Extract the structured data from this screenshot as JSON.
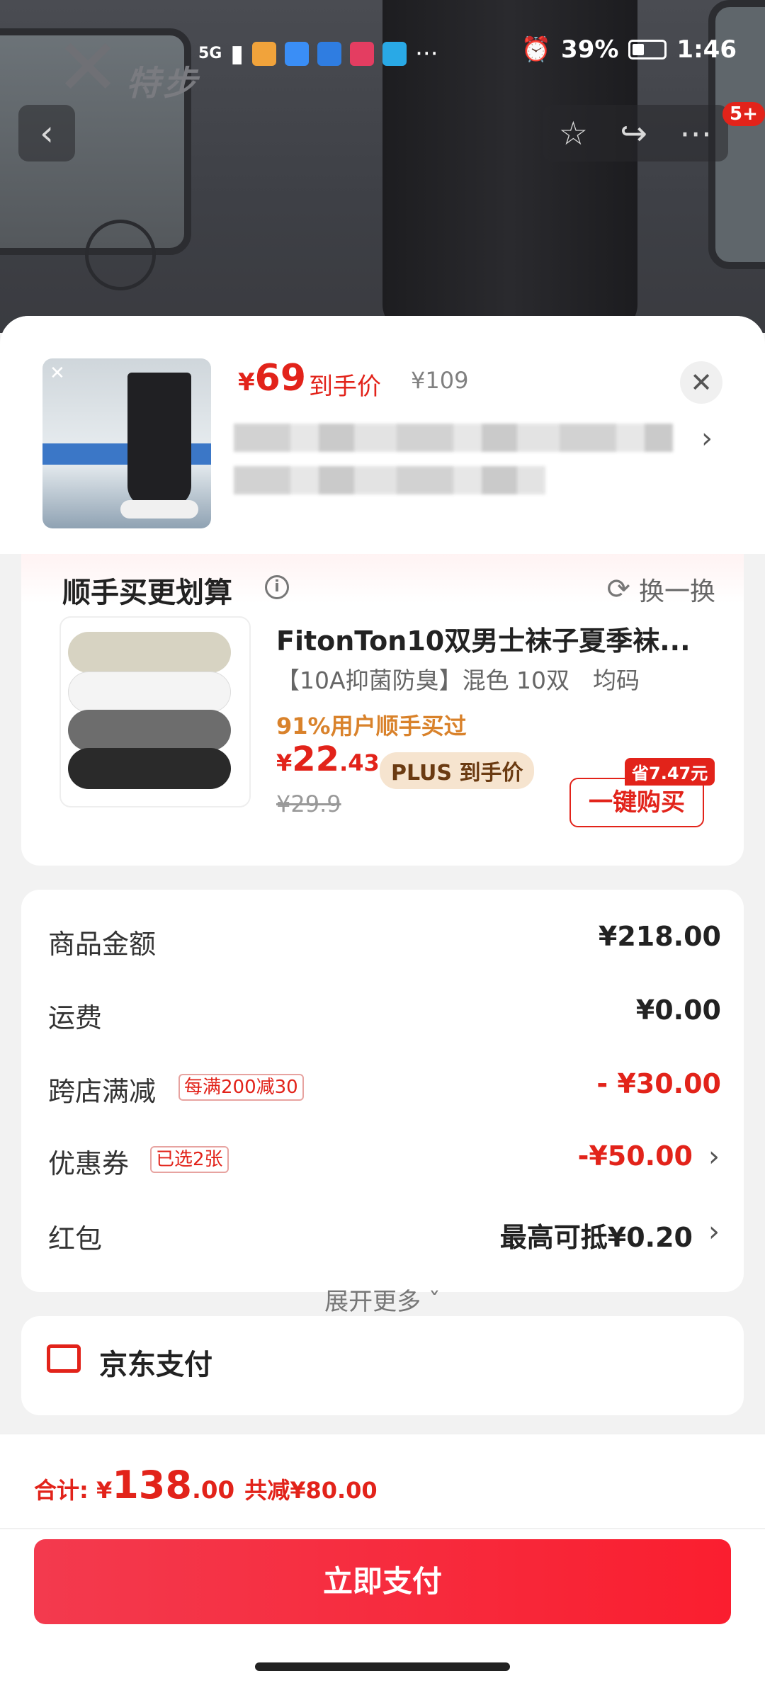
{
  "status_bar": {
    "time": "1:46",
    "battery": "39%",
    "battery_level": 0.39,
    "network": "5G"
  },
  "background": {
    "brand_text": "特步",
    "cart_badge": "5+"
  },
  "sheet": {
    "price_currency": "¥",
    "price": "69",
    "price_label": "到手价",
    "original_price": "¥109"
  },
  "recommend": {
    "title": "顺手买更划算",
    "refresh": "换一换",
    "name": "FitonTon10双男士袜子夏季袜...",
    "spec": "【10A抑菌防臭】混色 10双　均码",
    "bought": "91%用户顺手买过",
    "price_currency": "¥",
    "price_int": "22",
    "price_dec": ".43",
    "plus_tag": "PLUS 到手价",
    "original_price": "¥29.9",
    "save_tag": "省7.47元",
    "buy_button": "一键购买"
  },
  "summary": {
    "rows": [
      {
        "label": "商品金额",
        "tag": "",
        "value": "¥218.00"
      },
      {
        "label": "运费",
        "tag": "",
        "value": "¥0.00"
      },
      {
        "label": "跨店满减",
        "tag": "每满200减30",
        "value": "- ¥30.00"
      },
      {
        "label": "优惠券",
        "tag": "已选2张",
        "value": "-¥50.00"
      },
      {
        "label": "红包",
        "tag": "",
        "value": "最高可抵¥0.20"
      }
    ],
    "expand": "展开更多 ˇ"
  },
  "payment": {
    "label": "京东支付"
  },
  "footer": {
    "total_label": "合计: ¥",
    "total_int": "138",
    "total_dec": ".00",
    "saved": "共减¥80.00",
    "pay_button": "立即支付"
  },
  "colors": {
    "accent": "#e2231a",
    "plus": "#f6e4cf",
    "bought": "#d9822b"
  }
}
